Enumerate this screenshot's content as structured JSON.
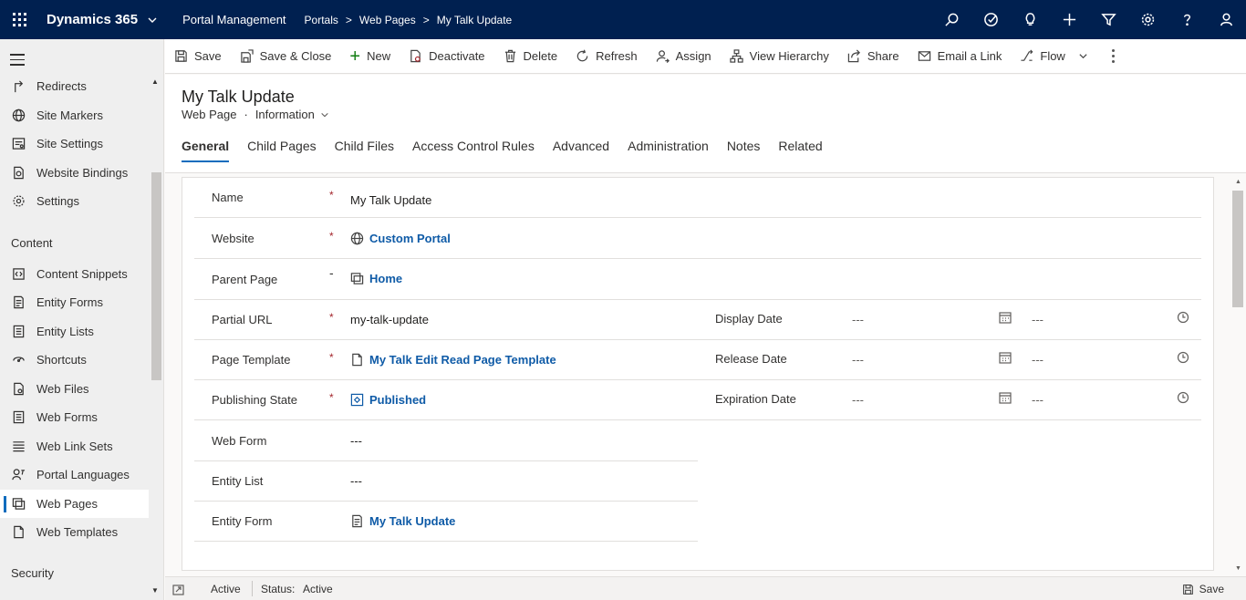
{
  "topbar": {
    "brand": "Dynamics 365",
    "app_name": "Portal Management",
    "breadcrumbs": [
      "Portals",
      "Web Pages",
      "My Talk Update"
    ],
    "icons": [
      "search-icon",
      "task-icon",
      "lightbulb-icon",
      "plus-icon",
      "filter-icon",
      "gear-icon",
      "help-icon",
      "user-icon"
    ]
  },
  "leftnav": {
    "items_top": [
      {
        "label": "Redirects",
        "icon": "redirect-icon"
      },
      {
        "label": "Site Markers",
        "icon": "globe-icon"
      },
      {
        "label": "Site Settings",
        "icon": "settings-list-icon"
      },
      {
        "label": "Website Bindings",
        "icon": "binding-icon"
      },
      {
        "label": "Settings",
        "icon": "gear-icon"
      }
    ],
    "group_content": "Content",
    "items_content": [
      {
        "label": "Content Snippets",
        "icon": "snippet-icon"
      },
      {
        "label": "Entity Forms",
        "icon": "form-icon"
      },
      {
        "label": "Entity Lists",
        "icon": "list-icon"
      },
      {
        "label": "Shortcuts",
        "icon": "shortcut-icon"
      },
      {
        "label": "Web Files",
        "icon": "file-icon"
      },
      {
        "label": "Web Forms",
        "icon": "form-icon"
      },
      {
        "label": "Web Link Sets",
        "icon": "linkset-icon"
      },
      {
        "label": "Portal Languages",
        "icon": "language-icon"
      },
      {
        "label": "Web Pages",
        "icon": "webpage-icon"
      },
      {
        "label": "Web Templates",
        "icon": "template-icon"
      }
    ],
    "group_security": "Security",
    "selected": "Web Pages"
  },
  "commands": {
    "save": "Save",
    "save_close": "Save & Close",
    "new": "New",
    "deactivate": "Deactivate",
    "delete": "Delete",
    "refresh": "Refresh",
    "assign": "Assign",
    "view_hierarchy": "View Hierarchy",
    "share": "Share",
    "email_link": "Email a Link",
    "flow": "Flow"
  },
  "record": {
    "title": "My Talk Update",
    "entity": "Web Page",
    "dot": "·",
    "form_name": "Information"
  },
  "tabs": [
    "General",
    "Child Pages",
    "Child Files",
    "Access Control Rules",
    "Advanced",
    "Administration",
    "Notes",
    "Related"
  ],
  "form": {
    "name": {
      "label": "Name",
      "req": "*",
      "value": "My Talk Update"
    },
    "website": {
      "label": "Website",
      "req": "*",
      "value": "Custom Portal"
    },
    "parent_page": {
      "label": "Parent Page",
      "req": "-",
      "value": "Home"
    },
    "partial_url": {
      "label": "Partial URL",
      "req": "*",
      "value": "my-talk-update"
    },
    "page_template": {
      "label": "Page Template",
      "req": "*",
      "value": "My Talk Edit Read Page Template"
    },
    "publishing_state": {
      "label": "Publishing State",
      "req": "*",
      "value": "Published"
    },
    "web_form": {
      "label": "Web Form",
      "value": "---"
    },
    "entity_list": {
      "label": "Entity List",
      "value": "---"
    },
    "entity_form": {
      "label": "Entity Form",
      "value": "My Talk Update"
    },
    "display_date": {
      "label": "Display Date",
      "date": "---",
      "time": "---"
    },
    "release_date": {
      "label": "Release Date",
      "date": "---",
      "time": "---"
    },
    "expiration_date": {
      "label": "Expiration Date",
      "date": "---",
      "time": "---"
    }
  },
  "status": {
    "state": "Active",
    "status_label": "Status:",
    "status_value": "Active",
    "save": "Save"
  }
}
